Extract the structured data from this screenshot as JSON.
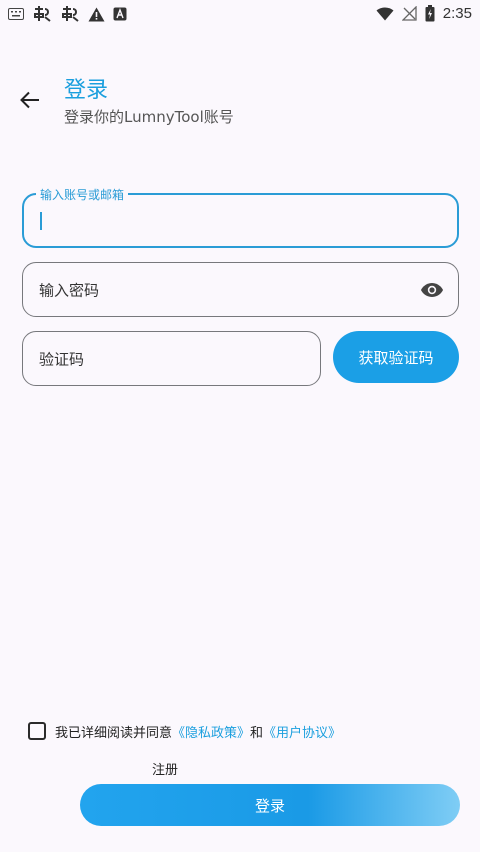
{
  "status_bar": {
    "time": "2:35",
    "left_icons": [
      "keyboard-icon",
      "app-icon",
      "app-icon",
      "warning-icon",
      "font-icon"
    ],
    "right_icons": [
      "wifi-icon",
      "no-signal-icon",
      "battery-icon"
    ]
  },
  "header": {
    "title": "登录",
    "subtitle": "登录你的LumnyTool账号"
  },
  "account_field": {
    "label": "输入账号或邮箱",
    "value": ""
  },
  "password_field": {
    "placeholder": "输入密码",
    "toggle_icon": "eye-icon"
  },
  "code_field": {
    "placeholder": "验证码"
  },
  "code_button": {
    "label": "获取验证码"
  },
  "agreement": {
    "text": "我已详细阅读并同意",
    "privacy_link": "《隐私政策》",
    "and": "和",
    "terms_link": "《用户协议》"
  },
  "register_link": "注册",
  "login_button": "登录",
  "colors": {
    "accent": "#1b9fde",
    "button": "#1b9fe6",
    "background": "#fbf8fd"
  }
}
